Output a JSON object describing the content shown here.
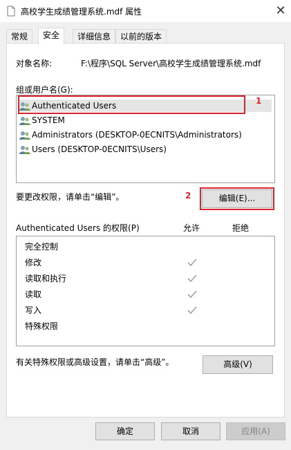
{
  "window": {
    "title": "高校学生成绩管理系统.mdf 属性",
    "close_glyph": "✕"
  },
  "tabs": [
    {
      "label": "常规"
    },
    {
      "label": "安全"
    },
    {
      "label": "详细信息"
    },
    {
      "label": "以前的版本"
    }
  ],
  "object": {
    "label": "对象名称:",
    "value": "F:\\程序\\SQL Server\\高校学生成绩管理系统.mdf"
  },
  "groups": {
    "label": "组或用户名(G):",
    "items": [
      {
        "name": "Authenticated Users"
      },
      {
        "name": "SYSTEM"
      },
      {
        "name": "Administrators (DESKTOP-0ECNITS\\Administrators)"
      },
      {
        "name": "Users (DESKTOP-0ECNITS\\Users)"
      }
    ]
  },
  "edit": {
    "hint": "要更改权限，请单击“编辑”。",
    "button_label": "编辑(E)..."
  },
  "permissions": {
    "header": "Authenticated Users 的权限(P)",
    "allow_label": "允许",
    "deny_label": "拒绝",
    "rows": [
      {
        "label": "完全控制",
        "allow": false
      },
      {
        "label": "修改",
        "allow": true
      },
      {
        "label": "读取和执行",
        "allow": true
      },
      {
        "label": "读取",
        "allow": true
      },
      {
        "label": "写入",
        "allow": true
      },
      {
        "label": "特殊权限",
        "allow": false
      }
    ]
  },
  "advanced": {
    "hint": "有关特殊权限或高级设置，请单击“高级”。",
    "button_label": "高级(V)"
  },
  "annotations": {
    "marker_1": "1",
    "marker_2": "2",
    "color": "#d9242b"
  },
  "footer": {
    "ok_label": "确定",
    "cancel_label": "取消",
    "apply_label": "应用(A)"
  }
}
